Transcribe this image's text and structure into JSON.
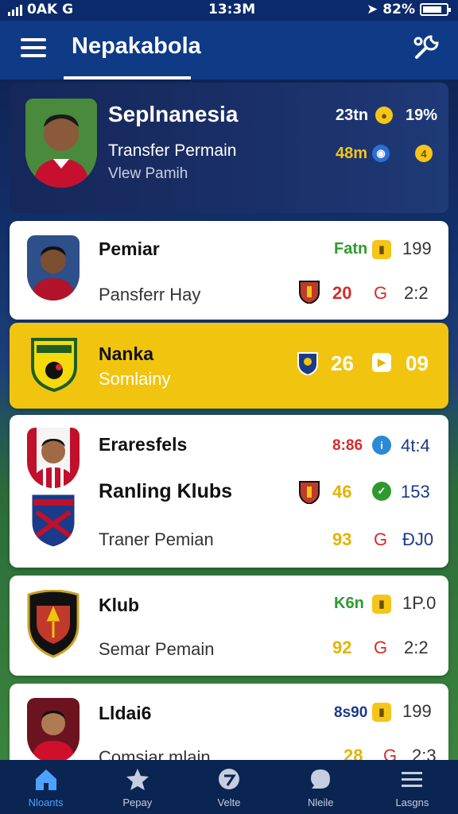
{
  "status": {
    "carrier": "0AK",
    "carrier_letter": "G",
    "time": "13:3M",
    "battery_percent": "82%",
    "battery_level": 0.82
  },
  "app_bar": {
    "title": "Nepakabola",
    "menu_icon": "hamburger-icon",
    "tools_icon": "tools-icon"
  },
  "hero": {
    "title": "Seplnanesia",
    "subtitle": "Transfer Permain",
    "link": "Vlew Pamih",
    "stat1": "23tn",
    "stat2": "19%",
    "stat3": "48m",
    "coin_label": "4"
  },
  "cards": [
    {
      "title": "Pemiar",
      "subtitle": "Pansferr Hay",
      "stat_top": "Fatn",
      "stat_top_right": "199",
      "stat_mid": "20",
      "stat_mid_letter": "G",
      "stat_mid_right": "2:2"
    },
    {
      "title": "Nanka",
      "subtitle": "Somlainy",
      "stat_big": "26",
      "stat_big_right": "09"
    },
    {
      "title": "Eraresfels",
      "title2": "Ranling Klubs",
      "subtitle": "Traner Pemian",
      "stat_top": "8:86",
      "stat_top_right": "4t:4",
      "stat_mid": "46",
      "stat_mid_right": "153",
      "stat_bot": "93",
      "stat_bot_letter": "G",
      "stat_bot_right": "ĐJ0"
    },
    {
      "title": "Klub",
      "subtitle": "Semar Pemain",
      "stat_top": "K6n",
      "stat_top_right": "1P.0",
      "stat_mid": "92",
      "stat_mid_letter": "G",
      "stat_mid_right": "2:2"
    },
    {
      "title": "Lldai6",
      "subtitle": "Comsiar mlain",
      "stat_top": "8s90",
      "stat_top_right": "199",
      "stat_mid": "28",
      "stat_mid_letter": "G",
      "stat_mid_right": "2:3"
    }
  ],
  "bottom_nav": [
    {
      "label": "Nloants",
      "icon": "home-icon"
    },
    {
      "label": "Pepay",
      "icon": "star-icon"
    },
    {
      "label": "Velte",
      "icon": "chat-icon"
    },
    {
      "label": "Nleile",
      "icon": "bubble-icon"
    },
    {
      "label": "Lasgns",
      "icon": "list-icon"
    }
  ],
  "colors": {
    "app_bar": "#0e3a86",
    "highlight_card": "#f1c40f",
    "red_stat": "#d62b2b",
    "yellow_stat": "#e4b400",
    "green_stat": "#2e9a2e",
    "nav_active": "#4ea1ff"
  }
}
